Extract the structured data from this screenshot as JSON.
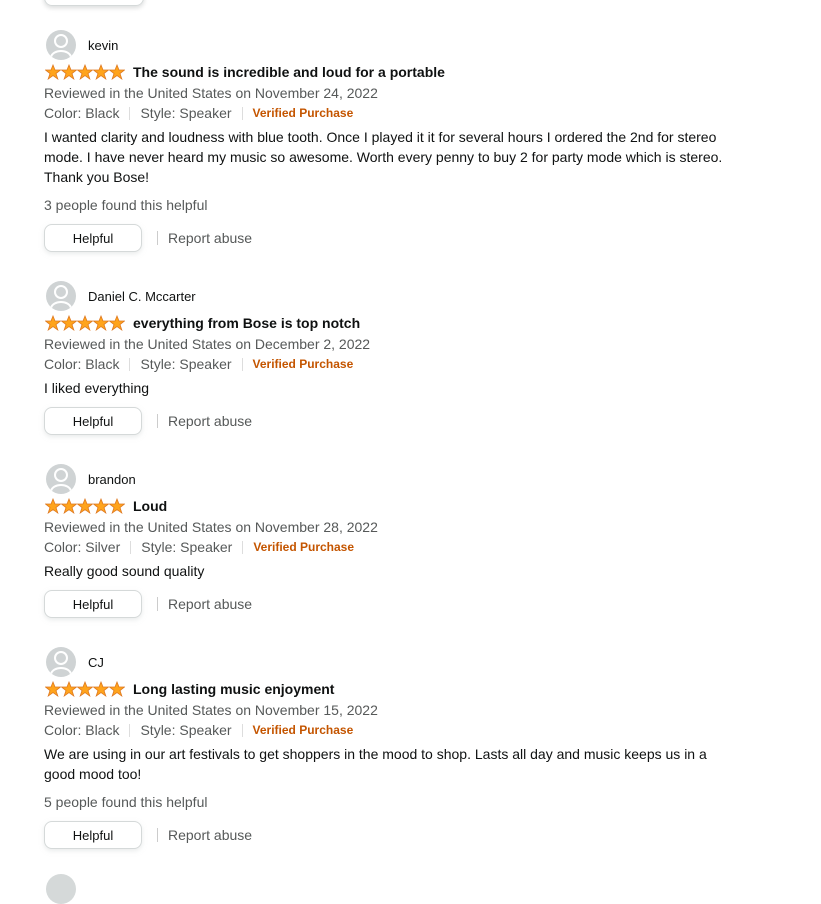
{
  "reviews": [
    {
      "reviewer": "kevin",
      "rating": 5,
      "title": "The sound is incredible and loud for a portable",
      "date_line": "Reviewed in the United States on November 24, 2022",
      "color": "Color: Black",
      "style": "Style: Speaker",
      "verified": "Verified Purchase",
      "body": "I wanted clarity and loudness with blue tooth. Once I played it it for several hours I ordered the 2nd for stereo mode. I have never heard my music so awesome. Worth every penny to buy 2 for party mode which is stereo. Thank you Bose!",
      "helpful_count": "3 people found this helpful",
      "helpful_label": "Helpful",
      "report_label": "Report abuse"
    },
    {
      "reviewer": "Daniel C. Mccarter",
      "rating": 5,
      "title": "everything from Bose is top notch",
      "date_line": "Reviewed in the United States on December 2, 2022",
      "color": "Color: Black",
      "style": "Style: Speaker",
      "verified": "Verified Purchase",
      "body": "I liked everything",
      "helpful_count": "",
      "helpful_label": "Helpful",
      "report_label": "Report abuse"
    },
    {
      "reviewer": "brandon",
      "rating": 5,
      "title": "Loud",
      "date_line": "Reviewed in the United States on November 28, 2022",
      "color": "Color: Silver",
      "style": "Style: Speaker",
      "verified": "Verified Purchase",
      "body": "Really good sound quality",
      "helpful_count": "",
      "helpful_label": "Helpful",
      "report_label": "Report abuse"
    },
    {
      "reviewer": "CJ",
      "rating": 5,
      "title": "Long lasting music enjoyment",
      "date_line": "Reviewed in the United States on November 15, 2022",
      "color": "Color: Black",
      "style": "Style: Speaker",
      "verified": "Verified Purchase",
      "body": "We are using in our art festivals to get shoppers in the mood to shop. Lasts all day and music keeps us in a good mood too!",
      "helpful_count": "5 people found this helpful",
      "helpful_label": "Helpful",
      "report_label": "Report abuse"
    }
  ],
  "colors": {
    "star_fill": "#ffa41c",
    "star_stroke": "#de7921",
    "verified": "#c45500",
    "meta_text": "#565959"
  },
  "icons": {
    "star": "star-icon",
    "avatar": "default-avatar-icon"
  }
}
